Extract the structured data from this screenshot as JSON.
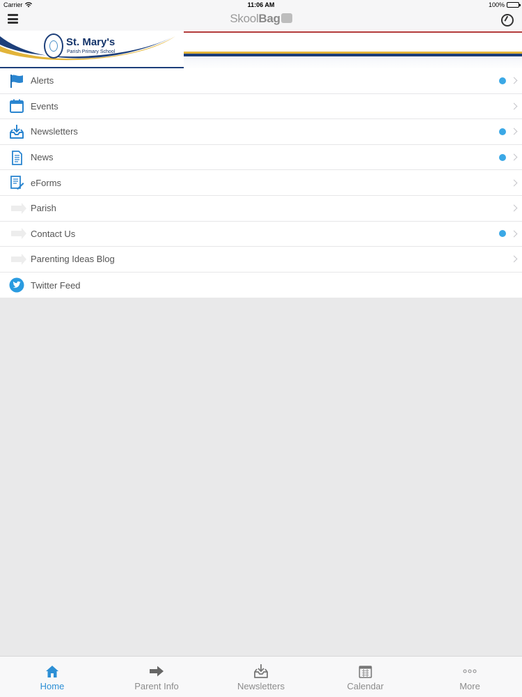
{
  "status_bar": {
    "carrier": "Carrier",
    "time": "11:06 AM",
    "battery": "100%"
  },
  "nav": {
    "brand_light": "Skool",
    "brand_bold": "Bag"
  },
  "banner": {
    "school_name": "St. Mary's",
    "school_subtitle": "Parish Primary School"
  },
  "colors": {
    "accent": "#2d8fd5",
    "badge": "#3ba8e6",
    "navy": "#1d3f7a",
    "gold": "#e2b43a"
  },
  "menu": {
    "items": [
      {
        "label": "Alerts",
        "icon": "flag-icon",
        "unread": true
      },
      {
        "label": "Events",
        "icon": "calendar-icon",
        "unread": false
      },
      {
        "label": "Newsletters",
        "icon": "inbox-download-icon",
        "unread": true
      },
      {
        "label": "News",
        "icon": "document-icon",
        "unread": true
      },
      {
        "label": "eForms",
        "icon": "form-edit-icon",
        "unread": false
      },
      {
        "label": "Parish",
        "icon": "arrow-right-icon",
        "unread": false
      },
      {
        "label": "Contact Us",
        "icon": "arrow-right-icon",
        "unread": true
      },
      {
        "label": "Parenting Ideas Blog",
        "icon": "arrow-right-icon",
        "unread": false
      },
      {
        "label": "Twitter Feed",
        "icon": "twitter-icon",
        "unread": false
      }
    ]
  },
  "tabs": [
    {
      "label": "Home",
      "icon": "home-icon",
      "active": true
    },
    {
      "label": "Parent Info",
      "icon": "arrow-right-icon",
      "active": false
    },
    {
      "label": "Newsletters",
      "icon": "inbox-download-icon",
      "active": false
    },
    {
      "label": "Calendar",
      "icon": "calendar-icon",
      "active": false
    },
    {
      "label": "More",
      "icon": "more-dots-icon",
      "active": false
    }
  ]
}
